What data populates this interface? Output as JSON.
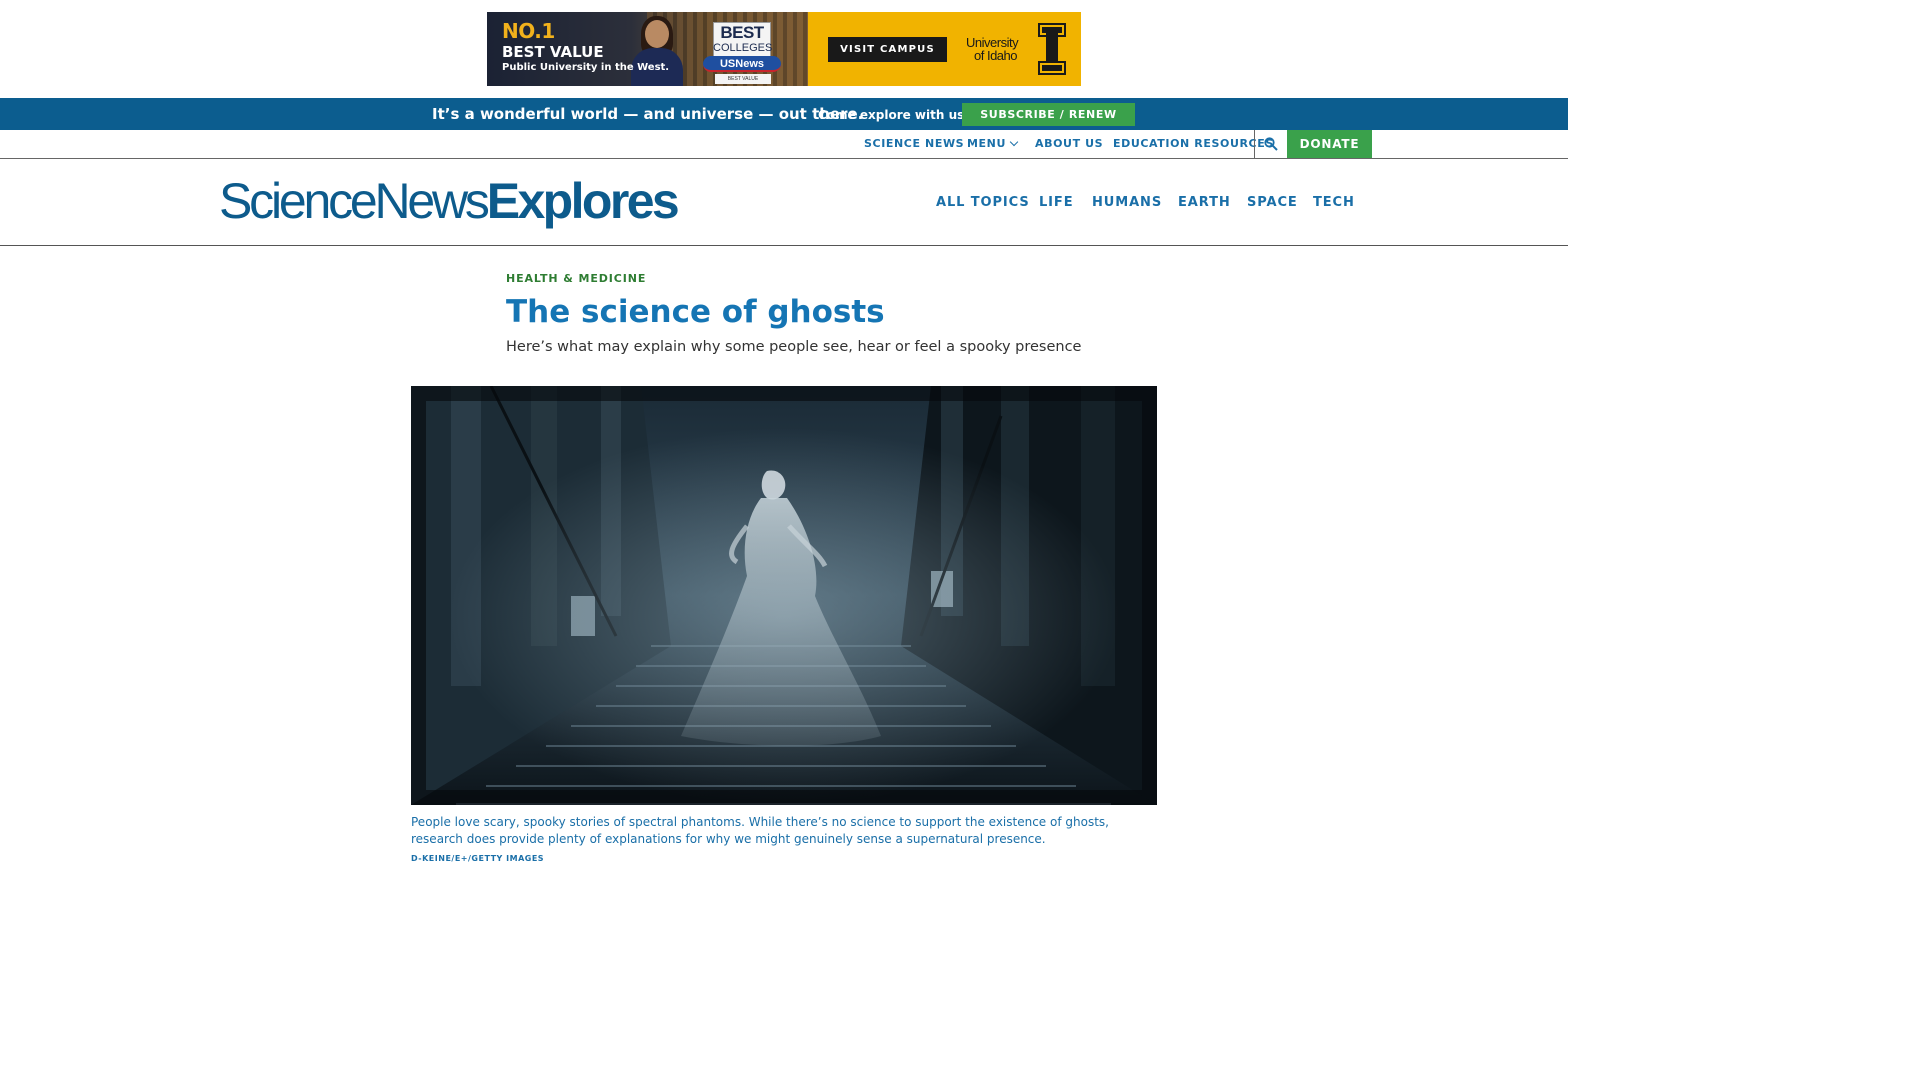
{
  "ad": {
    "headline_no1": "NO.1",
    "headline_best_value": "BEST VALUE",
    "subline": "Public University in the West.",
    "badge_best": "BEST",
    "badge_colleges": "COLLEGES",
    "badge_usnews": "USNews",
    "badge_footer": "BEST VALUE SCHOOLS",
    "cta_label": "VISIT CAMPUS",
    "university_line1": "University",
    "university_line2": "of Idaho",
    "accent_color": "#f1b300"
  },
  "promo": {
    "tagline": "It’s a wonderful world — and universe — out there.",
    "explore_text": "Come explore with us!",
    "subscribe_label": "SUBSCRIBE / RENEW NOW",
    "bar_color": "#0c5d8f"
  },
  "utility_nav": {
    "items": [
      {
        "label": "SCIENCE NEWS"
      },
      {
        "label": "MENU"
      },
      {
        "label": "ABOUT US"
      },
      {
        "label": "EDUCATION RESOURCES"
      }
    ],
    "search_icon": "search-icon",
    "donate_label": "DONATE"
  },
  "header": {
    "logo_part1": "ScienceNews",
    "logo_part2": "Explores",
    "nav": [
      {
        "label": "ALL TOPICS"
      },
      {
        "label": "LIFE"
      },
      {
        "label": "HUMANS"
      },
      {
        "label": "EARTH"
      },
      {
        "label": "SPACE"
      },
      {
        "label": "TECH"
      }
    ]
  },
  "article": {
    "kicker": "HEALTH & MEDICINE",
    "title": "The science of ghosts",
    "dek": "Here’s what may explain why some people see, hear or feel a spooky presence",
    "caption": "People love scary, spooky stories of spectral phantoms. While there’s no science to support the existence of ghosts, research does provide plenty of explanations for why we might genuinely sense a supernatural presence.",
    "credit": "D-KEINE/E+/GETTY IMAGES"
  },
  "colors": {
    "brand_blue": "#0d5b8c",
    "link_blue": "#1a6fa8",
    "green": "#3aa14b",
    "kicker_green": "#2e7d32"
  }
}
